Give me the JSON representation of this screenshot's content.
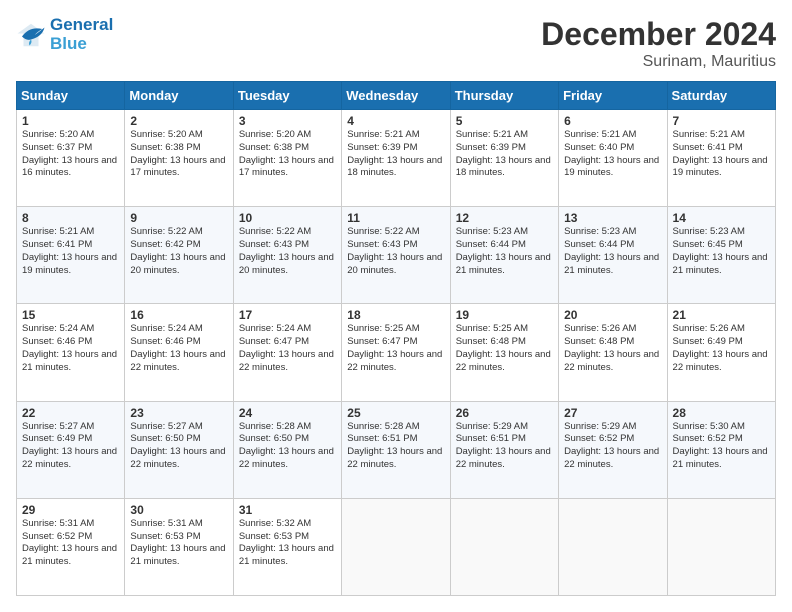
{
  "logo": {
    "line1": "General",
    "line2": "Blue"
  },
  "title": "December 2024",
  "subtitle": "Surinam, Mauritius",
  "headers": [
    "Sunday",
    "Monday",
    "Tuesday",
    "Wednesday",
    "Thursday",
    "Friday",
    "Saturday"
  ],
  "weeks": [
    [
      {
        "day": "1",
        "sunrise": "5:20 AM",
        "sunset": "6:37 PM",
        "daylight": "13 hours and 16 minutes."
      },
      {
        "day": "2",
        "sunrise": "5:20 AM",
        "sunset": "6:38 PM",
        "daylight": "13 hours and 17 minutes."
      },
      {
        "day": "3",
        "sunrise": "5:20 AM",
        "sunset": "6:38 PM",
        "daylight": "13 hours and 17 minutes."
      },
      {
        "day": "4",
        "sunrise": "5:21 AM",
        "sunset": "6:39 PM",
        "daylight": "13 hours and 18 minutes."
      },
      {
        "day": "5",
        "sunrise": "5:21 AM",
        "sunset": "6:39 PM",
        "daylight": "13 hours and 18 minutes."
      },
      {
        "day": "6",
        "sunrise": "5:21 AM",
        "sunset": "6:40 PM",
        "daylight": "13 hours and 19 minutes."
      },
      {
        "day": "7",
        "sunrise": "5:21 AM",
        "sunset": "6:41 PM",
        "daylight": "13 hours and 19 minutes."
      }
    ],
    [
      {
        "day": "8",
        "sunrise": "5:21 AM",
        "sunset": "6:41 PM",
        "daylight": "13 hours and 19 minutes."
      },
      {
        "day": "9",
        "sunrise": "5:22 AM",
        "sunset": "6:42 PM",
        "daylight": "13 hours and 20 minutes."
      },
      {
        "day": "10",
        "sunrise": "5:22 AM",
        "sunset": "6:43 PM",
        "daylight": "13 hours and 20 minutes."
      },
      {
        "day": "11",
        "sunrise": "5:22 AM",
        "sunset": "6:43 PM",
        "daylight": "13 hours and 20 minutes."
      },
      {
        "day": "12",
        "sunrise": "5:23 AM",
        "sunset": "6:44 PM",
        "daylight": "13 hours and 21 minutes."
      },
      {
        "day": "13",
        "sunrise": "5:23 AM",
        "sunset": "6:44 PM",
        "daylight": "13 hours and 21 minutes."
      },
      {
        "day": "14",
        "sunrise": "5:23 AM",
        "sunset": "6:45 PM",
        "daylight": "13 hours and 21 minutes."
      }
    ],
    [
      {
        "day": "15",
        "sunrise": "5:24 AM",
        "sunset": "6:46 PM",
        "daylight": "13 hours and 21 minutes."
      },
      {
        "day": "16",
        "sunrise": "5:24 AM",
        "sunset": "6:46 PM",
        "daylight": "13 hours and 22 minutes."
      },
      {
        "day": "17",
        "sunrise": "5:24 AM",
        "sunset": "6:47 PM",
        "daylight": "13 hours and 22 minutes."
      },
      {
        "day": "18",
        "sunrise": "5:25 AM",
        "sunset": "6:47 PM",
        "daylight": "13 hours and 22 minutes."
      },
      {
        "day": "19",
        "sunrise": "5:25 AM",
        "sunset": "6:48 PM",
        "daylight": "13 hours and 22 minutes."
      },
      {
        "day": "20",
        "sunrise": "5:26 AM",
        "sunset": "6:48 PM",
        "daylight": "13 hours and 22 minutes."
      },
      {
        "day": "21",
        "sunrise": "5:26 AM",
        "sunset": "6:49 PM",
        "daylight": "13 hours and 22 minutes."
      }
    ],
    [
      {
        "day": "22",
        "sunrise": "5:27 AM",
        "sunset": "6:49 PM",
        "daylight": "13 hours and 22 minutes."
      },
      {
        "day": "23",
        "sunrise": "5:27 AM",
        "sunset": "6:50 PM",
        "daylight": "13 hours and 22 minutes."
      },
      {
        "day": "24",
        "sunrise": "5:28 AM",
        "sunset": "6:50 PM",
        "daylight": "13 hours and 22 minutes."
      },
      {
        "day": "25",
        "sunrise": "5:28 AM",
        "sunset": "6:51 PM",
        "daylight": "13 hours and 22 minutes."
      },
      {
        "day": "26",
        "sunrise": "5:29 AM",
        "sunset": "6:51 PM",
        "daylight": "13 hours and 22 minutes."
      },
      {
        "day": "27",
        "sunrise": "5:29 AM",
        "sunset": "6:52 PM",
        "daylight": "13 hours and 22 minutes."
      },
      {
        "day": "28",
        "sunrise": "5:30 AM",
        "sunset": "6:52 PM",
        "daylight": "13 hours and 21 minutes."
      }
    ],
    [
      {
        "day": "29",
        "sunrise": "5:31 AM",
        "sunset": "6:52 PM",
        "daylight": "13 hours and 21 minutes."
      },
      {
        "day": "30",
        "sunrise": "5:31 AM",
        "sunset": "6:53 PM",
        "daylight": "13 hours and 21 minutes."
      },
      {
        "day": "31",
        "sunrise": "5:32 AM",
        "sunset": "6:53 PM",
        "daylight": "13 hours and 21 minutes."
      },
      null,
      null,
      null,
      null
    ]
  ]
}
